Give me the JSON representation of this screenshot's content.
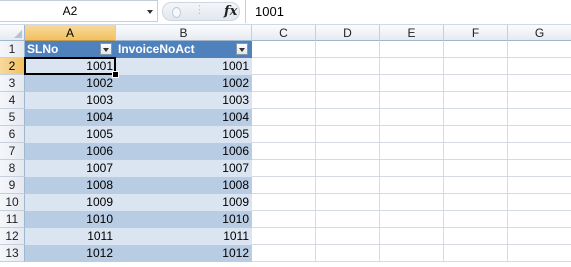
{
  "name_box": {
    "value": "A2"
  },
  "formula_bar": {
    "fx_label": "fx",
    "value": "1001"
  },
  "columns": [
    "A",
    "B",
    "C",
    "D",
    "E",
    "F",
    "G"
  ],
  "selected_column": "A",
  "selected_row": "2",
  "rows": [
    "1",
    "2",
    "3",
    "4",
    "5",
    "6",
    "7",
    "8",
    "9",
    "10",
    "11",
    "12",
    "13"
  ],
  "table": {
    "headers": [
      "SLNo",
      "InvoiceNoAct"
    ],
    "data": [
      [
        "1001",
        "1001"
      ],
      [
        "1002",
        "1002"
      ],
      [
        "1003",
        "1003"
      ],
      [
        "1004",
        "1004"
      ],
      [
        "1005",
        "1005"
      ],
      [
        "1006",
        "1006"
      ],
      [
        "1007",
        "1007"
      ],
      [
        "1008",
        "1008"
      ],
      [
        "1009",
        "1009"
      ],
      [
        "1010",
        "1010"
      ],
      [
        "1011",
        "1011"
      ],
      [
        "1012",
        "1012"
      ]
    ]
  },
  "colors": {
    "table_header": "#4f81bd",
    "band_dark": "#b8cce4",
    "band_light": "#dbe5f1",
    "selection": "#f1c15f"
  },
  "icons": {
    "filter": "filter-dropdown-icon",
    "namebox_dropdown": "chevron-down-icon",
    "function": "function-icon"
  }
}
